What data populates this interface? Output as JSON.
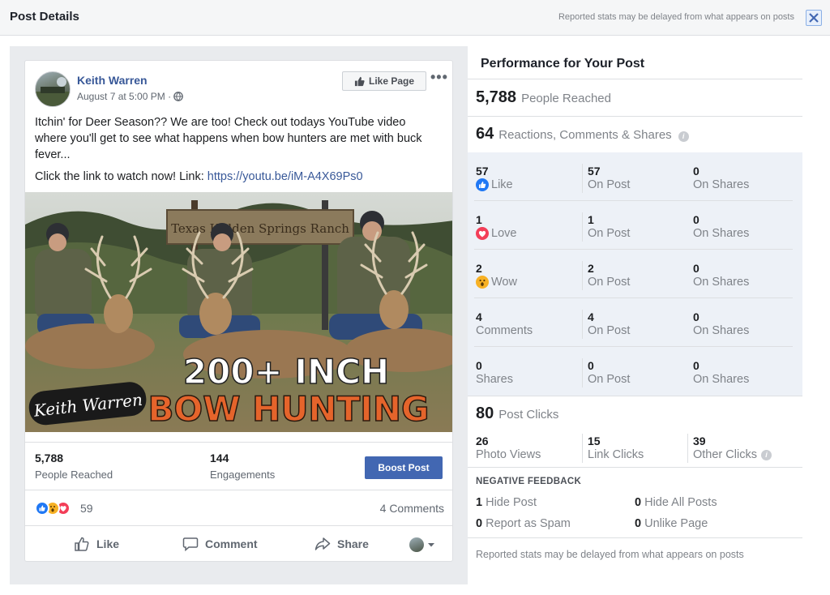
{
  "window": {
    "title": "Post Details",
    "top_note": "Reported stats may be delayed from what appears on posts",
    "close_icon": "close-icon"
  },
  "post": {
    "author": "Keith Warren",
    "date": "August 7 at 5:00 PM ·",
    "privacy_icon": "globe-icon",
    "like_page_label": "Like Page",
    "more_label": "•••",
    "text_line1": "Itchin' for Deer Season?? We are too! Check out todays YouTube video where you'll get to see what happens when bow hunters are met with buck fever...",
    "text_line2_prefix": "Click the link to watch now! Link: ",
    "link": "https://youtu.be/iM-A4X69Ps0",
    "image": {
      "sign_text": "Texas Hidden Springs Ranch",
      "headline1": "200+ INCH",
      "headline2": "BOW HUNTING",
      "signature": "Keith Warren"
    },
    "stats": {
      "reached_value": "5,788",
      "reached_label": "People Reached",
      "engagements_value": "144",
      "engagements_label": "Engagements",
      "boost_label": "Boost Post"
    },
    "reactions": {
      "count": "59",
      "comments": "4 Comments",
      "colors": {
        "like": "#2078f4",
        "wow": "#f7b125",
        "love": "#f33e58"
      }
    },
    "actions": {
      "like": "Like",
      "comment": "Comment",
      "share": "Share"
    }
  },
  "performance": {
    "title": "Performance for Your Post",
    "reached_value": "5,788",
    "reached_label": "People Reached",
    "rcs_value": "64",
    "rcs_label": "Reactions, Comments & Shares",
    "rows": [
      {
        "count": "57",
        "label": "Like",
        "icon": "like-icon",
        "on_post": "57",
        "on_post_label": "On Post",
        "on_shares": "0",
        "on_shares_label": "On Shares"
      },
      {
        "count": "1",
        "label": "Love",
        "icon": "love-icon",
        "on_post": "1",
        "on_post_label": "On Post",
        "on_shares": "0",
        "on_shares_label": "On Shares"
      },
      {
        "count": "2",
        "label": "Wow",
        "icon": "wow-icon",
        "on_post": "2",
        "on_post_label": "On Post",
        "on_shares": "0",
        "on_shares_label": "On Shares"
      },
      {
        "count": "4",
        "label": "Comments",
        "icon": "",
        "on_post": "4",
        "on_post_label": "On Post",
        "on_shares": "0",
        "on_shares_label": "On Shares"
      },
      {
        "count": "0",
        "label": "Shares",
        "icon": "",
        "on_post": "0",
        "on_post_label": "On Post",
        "on_shares": "0",
        "on_shares_label": "On Shares"
      }
    ],
    "clicks_value": "80",
    "clicks_label": "Post Clicks",
    "clicks": {
      "photo_views": "26",
      "photo_views_label": "Photo Views",
      "link_clicks": "15",
      "link_clicks_label": "Link Clicks",
      "other_clicks": "39",
      "other_clicks_label": "Other Clicks"
    },
    "negative": {
      "title": "NEGATIVE FEEDBACK",
      "hide_post": "1",
      "hide_post_label": "Hide Post",
      "hide_all": "0",
      "hide_all_label": "Hide All Posts",
      "spam": "0",
      "spam_label": "Report as Spam",
      "unlike": "0",
      "unlike_label": "Unlike Page"
    },
    "footnote": "Reported stats may be delayed from what appears on posts"
  }
}
